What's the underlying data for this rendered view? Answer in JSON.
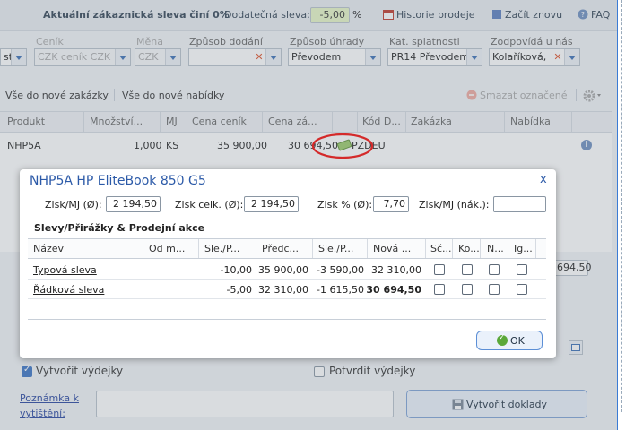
{
  "topbar": {
    "discount_text": "Aktuální zákaznická sleva činí 0%",
    "additional_label": "Dodatečná sleva:",
    "additional_value": "-5,00",
    "percent": "%",
    "history": "Historie prodeje",
    "restart": "Začít znovu",
    "faq": "FAQ"
  },
  "fields": {
    "stub_value": "st",
    "pricelist_label": "Ceník",
    "pricelist_value": "CZK ceník CZK",
    "currency_label": "Měna",
    "currency_value": "CZK",
    "delivery_label": "Způsob dodání",
    "payment_label": "Způsob úhrady",
    "payment_value": "Převodem",
    "due_label": "Kat. splatnosti",
    "due_value": "PR14 Převodem",
    "owner_label": "Zodpovídá u nás",
    "owner_value": "Kolaříková,"
  },
  "toolbar": {
    "all_to_order": "Vše do nové zakázky",
    "all_to_offer": "Vše do nové nabídky",
    "delete_marked": "Smazat označené"
  },
  "grid": {
    "headers": [
      "Produkt",
      "Množství...",
      "MJ",
      "Cena ceník",
      "Cena zá...",
      "Kód D...",
      "Zakázka",
      "Nabídka"
    ],
    "row": {
      "product": "NHP5A",
      "qty": "1,000",
      "unit": "KS",
      "list_price": "35 900,00",
      "price": "30 694,50",
      "code": "PZDEU"
    },
    "side_value": "694,50"
  },
  "bottom": {
    "create_dispatch": "Vytvořit výdejky",
    "confirm_dispatch": "Potvrdit výdejky",
    "note_label_1": "Poznámka k",
    "note_label_2": "vytištění:",
    "create_docs": "Vytvořit doklady"
  },
  "dialog": {
    "title": "NHP5A HP EliteBook 850 G5",
    "close": "x",
    "profit_unit_label": "Zisk/MJ (Ø):",
    "profit_unit_value": "2 194,50",
    "profit_total_label": "Zisk celk. (Ø):",
    "profit_total_value": "2 194,50",
    "profit_pct_label": "Zisk % (Ø):",
    "profit_pct_value": "7,70",
    "profit_purchase_label": "Zisk/MJ (nák.):",
    "profit_purchase_value": "",
    "section_title": "Slevy/Přirážky & Prodejní akce",
    "columns": [
      "Název",
      "Od m...",
      "Sle./P...",
      "Předc...",
      "Sle./P...",
      "Nová ...",
      "Sč...",
      "Ko...",
      "N...",
      "Ig..."
    ],
    "rows": [
      {
        "name": "Typová sleva",
        "from": "",
        "disc_pct": "-10,00",
        "prev": "35 900,00",
        "disc_amt": "-3 590,00",
        "new": "32 310,00"
      },
      {
        "name": "Řádková sleva",
        "from": "",
        "disc_pct": "-5,00",
        "prev": "32 310,00",
        "disc_amt": "-1 615,50",
        "new": "30 694,50"
      }
    ],
    "ok": "OK"
  }
}
